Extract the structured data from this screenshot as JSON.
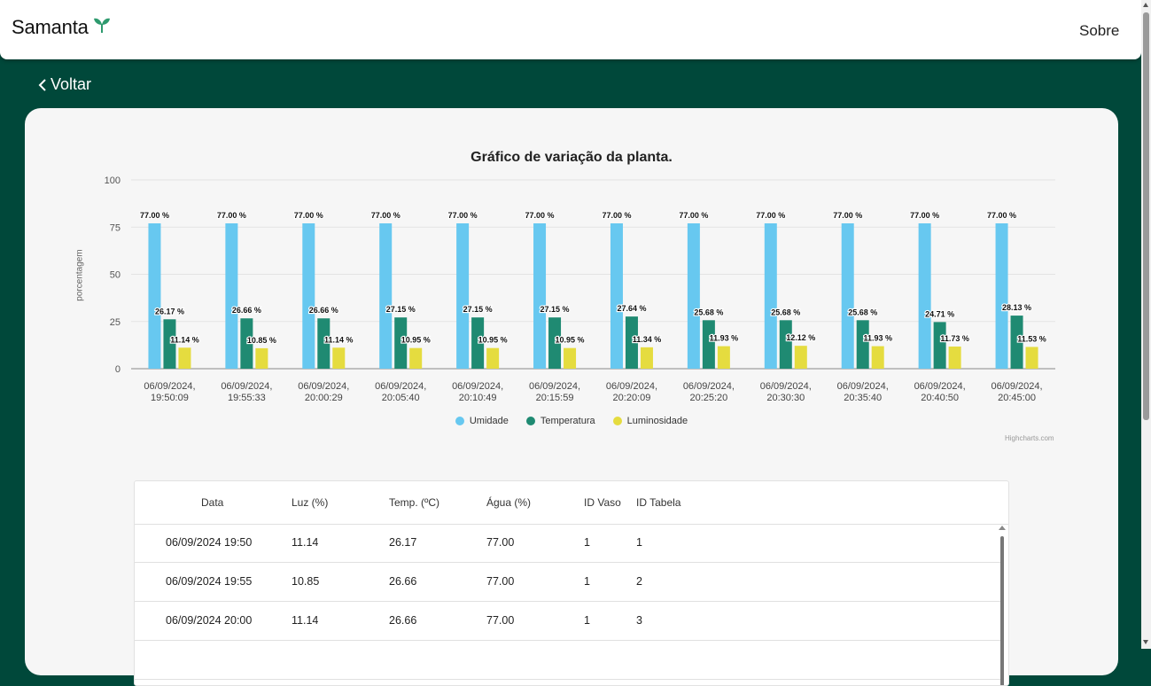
{
  "nav": {
    "brand": "Samanta",
    "brand_icon": "sprout-icon",
    "sobre": "Sobre"
  },
  "back": {
    "label": "Voltar",
    "icon": "chevron-left-icon"
  },
  "chart_data": {
    "type": "bar",
    "title": "Gráfico de variação da planta.",
    "ylabel": "porcentagem",
    "xlabel": "",
    "ylim": [
      0,
      100
    ],
    "yticks": [
      0,
      25,
      50,
      75,
      100
    ],
    "categories": [
      [
        "06/09/2024,",
        "19:50:09"
      ],
      [
        "06/09/2024,",
        "19:55:33"
      ],
      [
        "06/09/2024,",
        "20:00:29"
      ],
      [
        "06/09/2024,",
        "20:05:40"
      ],
      [
        "06/09/2024,",
        "20:10:49"
      ],
      [
        "06/09/2024,",
        "20:15:59"
      ],
      [
        "06/09/2024,",
        "20:20:09"
      ],
      [
        "06/09/2024,",
        "20:25:20"
      ],
      [
        "06/09/2024,",
        "20:30:30"
      ],
      [
        "06/09/2024,",
        "20:35:40"
      ],
      [
        "06/09/2024,",
        "20:40:50"
      ],
      [
        "06/09/2024,",
        "20:45:00"
      ]
    ],
    "series": [
      {
        "name": "Umidade",
        "color": "#67c8f0",
        "values": [
          77.0,
          77.0,
          77.0,
          77.0,
          77.0,
          77.0,
          77.0,
          77.0,
          77.0,
          77.0,
          77.0,
          77.0
        ]
      },
      {
        "name": "Temperatura",
        "color": "#1f8a72",
        "values": [
          26.17,
          26.66,
          26.66,
          27.15,
          27.15,
          27.15,
          27.64,
          25.68,
          25.68,
          25.68,
          24.71,
          28.13
        ]
      },
      {
        "name": "Luminosidade",
        "color": "#e5dc3f",
        "values": [
          11.14,
          10.85,
          11.14,
          10.95,
          10.95,
          10.95,
          11.34,
          11.93,
          12.12,
          11.93,
          11.73,
          11.53
        ]
      }
    ],
    "data_label_suffix": " %",
    "legend": "bottom-center",
    "grid": true,
    "credits": "Highcharts.com"
  },
  "table": {
    "headers": [
      "Data",
      "Luz (%)",
      "Temp. (ºC)",
      "Água (%)",
      "ID Vaso",
      "ID Tabela"
    ],
    "rows": [
      [
        "06/09/2024 19:50",
        "11.14",
        "26.17",
        "77.00",
        "1",
        "1"
      ],
      [
        "06/09/2024 19:55",
        "10.85",
        "26.66",
        "77.00",
        "1",
        "2"
      ],
      [
        "06/09/2024 20:00",
        "11.14",
        "26.66",
        "77.00",
        "1",
        "3"
      ],
      [
        "",
        "",
        "",
        "",
        "",
        ""
      ]
    ]
  }
}
